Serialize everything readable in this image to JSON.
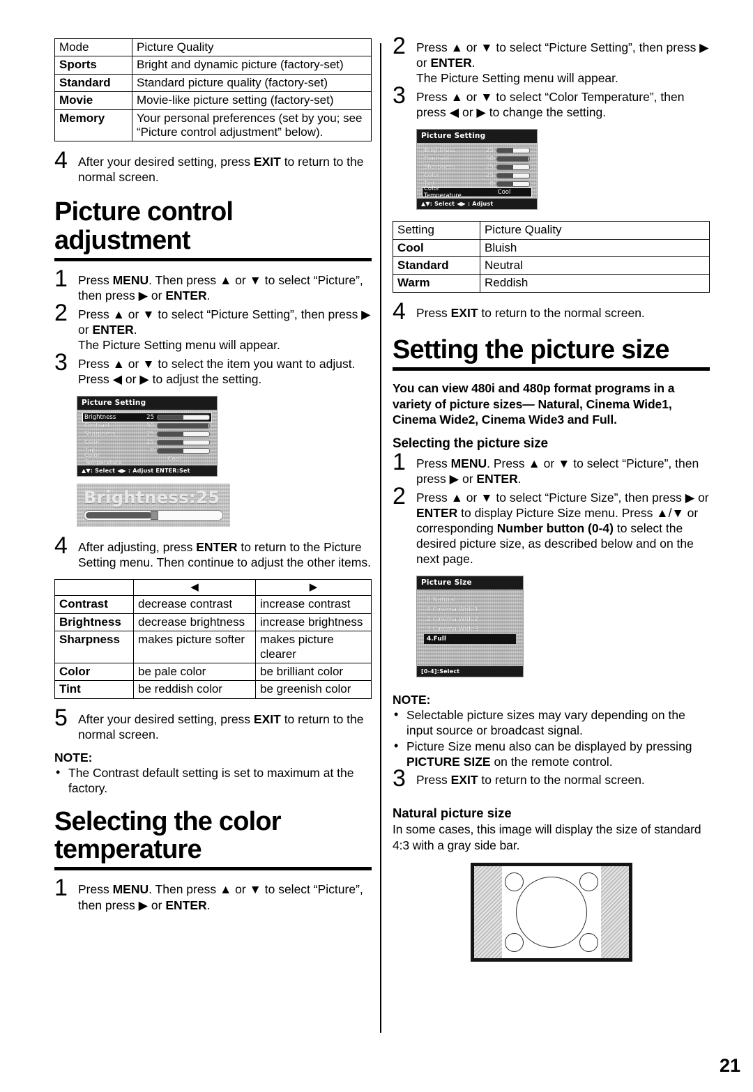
{
  "page": {
    "number": "21"
  },
  "left_column": {
    "picture_quality_table": {
      "header": [
        "Mode",
        "Picture Quality"
      ],
      "rows": [
        {
          "mode": "Sports",
          "quality": "Bright and dynamic picture (factory-set)"
        },
        {
          "mode": "Standard",
          "quality": "Standard picture quality (factory-set)"
        },
        {
          "mode": "Movie",
          "quality": "Movie-like picture setting (factory-set)"
        },
        {
          "mode": "Memory",
          "quality": "Your personal preferences (set by you; see “Picture control adjustment” below)."
        }
      ]
    },
    "step4_above": {
      "num": "4",
      "text_before": "After your desired setting, press ",
      "bold": "EXIT",
      "text_after": " to return to the normal screen."
    },
    "heading_picture_control": "Picture control adjustment",
    "steps": [
      {
        "num": "1",
        "parts": [
          {
            "t": "Press ",
            "b": false
          },
          {
            "t": "MENU",
            "b": true
          },
          {
            "t": ". Then press ▲ or ▼ to select “Picture”, then press ▶ or ",
            "b": false
          },
          {
            "t": "ENTER",
            "b": true
          },
          {
            "t": ".",
            "b": false
          }
        ]
      },
      {
        "num": "2",
        "parts": [
          {
            "t": "Press ▲ or ▼ to select “Picture Setting”, then press ▶ or ",
            "b": false
          },
          {
            "t": "ENTER",
            "b": true
          },
          {
            "t": ".",
            "b": false
          },
          {
            "t": "\nThe Picture Setting menu will appear.",
            "b": false
          }
        ]
      },
      {
        "num": "3",
        "parts": [
          {
            "t": "Press ▲ or ▼ to select the item you want to adjust.",
            "b": false
          },
          {
            "t": "\nPress ◀ or ▶ to adjust the setting.",
            "b": false
          }
        ]
      }
    ],
    "osd_picture_setting": {
      "title": "Picture Setting",
      "rows": [
        {
          "label": "Brightness",
          "value": "25",
          "fill_pct": 50,
          "selected": true
        },
        {
          "label": "Contrast",
          "value": "50",
          "fill_pct": 98,
          "selected": false
        },
        {
          "label": "Sharpness",
          "value": "25",
          "fill_pct": 50,
          "selected": false
        },
        {
          "label": "Color",
          "value": "25",
          "fill_pct": 50,
          "selected": false
        },
        {
          "label": "Tint",
          "value": "0",
          "fill_pct": 50,
          "selected": false
        },
        {
          "label": "Color Temperature",
          "value": "Cool",
          "is_text": true,
          "selected": false
        }
      ],
      "footer": "▲▼: Select   ◀▶ : Adjust   ENTER:Set"
    },
    "osd_brightness_popup": {
      "label": "Brightness:25",
      "fill_pct": 50
    },
    "step4_adjust": {
      "num": "4",
      "parts": [
        {
          "t": "After adjusting, press ",
          "b": false
        },
        {
          "t": "ENTER",
          "b": true
        },
        {
          "t": " to return to the Picture Setting menu. Then continue to adjust the other items.",
          "b": false
        }
      ]
    },
    "adjust_table": {
      "header": [
        "",
        "◀",
        "▶"
      ],
      "rows": [
        {
          "item": "Contrast",
          "left": "decrease contrast",
          "right": "increase contrast"
        },
        {
          "item": "Brightness",
          "left": "decrease brightness",
          "right": "increase brightness"
        },
        {
          "item": "Sharpness",
          "left": "makes picture softer",
          "right": "makes picture clearer"
        },
        {
          "item": "Color",
          "left": "be pale color",
          "right": "be brilliant color"
        },
        {
          "item": "Tint",
          "left": "be reddish color",
          "right": "be greenish color"
        }
      ]
    },
    "step5": {
      "num": "5",
      "parts": [
        {
          "t": "After your desired setting, press ",
          "b": false
        },
        {
          "t": "EXIT",
          "b": true
        },
        {
          "t": " to return to the normal screen.",
          "b": false
        }
      ]
    },
    "note_contrast": {
      "title": "NOTE:",
      "bullets": [
        "The Contrast default setting is set to maximum at the factory."
      ]
    },
    "heading_color_temperature": "Selecting the color temperature",
    "color_temp_step1": {
      "num": "1",
      "parts": [
        {
          "t": "Press ",
          "b": false
        },
        {
          "t": "MENU",
          "b": true
        },
        {
          "t": ". Then press ▲ or ▼ to select “Picture”, then press ▶ or ",
          "b": false
        },
        {
          "t": "ENTER",
          "b": true
        },
        {
          "t": ".",
          "b": false
        }
      ]
    }
  },
  "right_column": {
    "steps_top": [
      {
        "num": "2",
        "parts": [
          {
            "t": "Press ▲ or ▼ to select “Picture Setting”, then press ▶ or ",
            "b": false
          },
          {
            "t": "ENTER",
            "b": true
          },
          {
            "t": ".",
            "b": false
          },
          {
            "t": "\nThe Picture Setting menu will appear.",
            "b": false
          }
        ]
      },
      {
        "num": "3",
        "parts": [
          {
            "t": "Press ▲ or ▼ to select “Color Temperature”, then press ◀ or ▶ to change the setting.",
            "b": false
          }
        ]
      }
    ],
    "osd_picture_setting": {
      "title": "Picture Setting",
      "rows": [
        {
          "label": "Brightness",
          "value": "25",
          "fill_pct": 50,
          "selected": false
        },
        {
          "label": "Contrast",
          "value": "50",
          "fill_pct": 98,
          "selected": false
        },
        {
          "label": "Sharpness",
          "value": "25",
          "fill_pct": 50,
          "selected": false
        },
        {
          "label": "Color",
          "value": "25",
          "fill_pct": 50,
          "selected": false
        },
        {
          "label": "Tint",
          "value": "0",
          "fill_pct": 50,
          "selected": false
        },
        {
          "label": "Color Temperature",
          "value": "Cool",
          "is_text": true,
          "selected": true
        }
      ],
      "footer": "▲▼: Select   ◀▶ : Adjust"
    },
    "color_temp_table": {
      "header": [
        "Setting",
        "Picture Quality"
      ],
      "rows": [
        {
          "setting": "Cool",
          "quality": "Bluish"
        },
        {
          "setting": "Standard",
          "quality": "Neutral"
        },
        {
          "setting": "Warm",
          "quality": "Reddish"
        }
      ]
    },
    "step4_exit": {
      "num": "4",
      "parts": [
        {
          "t": "Press ",
          "b": false
        },
        {
          "t": "EXIT",
          "b": true
        },
        {
          "t": " to return to the normal screen.",
          "b": false
        }
      ]
    },
    "heading_picture_size": "Setting the picture size",
    "intro_bold": "You can view 480i and 480p format programs in a variety of picture sizes— Natural, Cinema Wide1, Cinema Wide2, Cinema Wide3 and Full.",
    "subheading_selecting": "Selecting the picture size",
    "size_steps": [
      {
        "num": "1",
        "parts": [
          {
            "t": "Press ",
            "b": false
          },
          {
            "t": "MENU",
            "b": true
          },
          {
            "t": ". Press ▲ or ▼ to select “Picture”, then press ▶ or ",
            "b": false
          },
          {
            "t": "ENTER",
            "b": true
          },
          {
            "t": ".",
            "b": false
          }
        ]
      },
      {
        "num": "2",
        "parts": [
          {
            "t": "Press ▲ or ▼ to select “Picture Size”, then press ▶ or ",
            "b": false
          },
          {
            "t": "ENTER",
            "b": true
          },
          {
            "t": " to display Picture Size menu. Press ▲/▼ or corresponding ",
            "b": false
          },
          {
            "t": "Number button (0-4)",
            "b": true
          },
          {
            "t": " to select the desired picture size, as described below and on the next page.",
            "b": false
          }
        ]
      }
    ],
    "osd_picture_size": {
      "title": "Picture Size",
      "items": [
        {
          "label": "0.Natural",
          "selected": false
        },
        {
          "label": "1.Cinema Wide1",
          "selected": false
        },
        {
          "label": "2.Cinema Wide2",
          "selected": false
        },
        {
          "label": "3.Cinema Wide3",
          "selected": false
        },
        {
          "label": "4.Full",
          "selected": true
        }
      ],
      "footer": "[0-4]:Select"
    },
    "note_picture_size": {
      "title": "NOTE:",
      "bullets": [
        {
          "parts": [
            {
              "t": "Selectable picture sizes may vary depending on the input source or broadcast signal.",
              "b": false
            }
          ]
        },
        {
          "parts": [
            {
              "t": "Picture Size menu also can be displayed by pressing ",
              "b": false
            },
            {
              "t": "PICTURE SIZE",
              "b": true
            },
            {
              "t": " on the remote control.",
              "b": false
            }
          ]
        }
      ]
    },
    "step3_exit": {
      "num": "3",
      "parts": [
        {
          "t": "Press ",
          "b": false
        },
        {
          "t": "EXIT",
          "b": true
        },
        {
          "t": " to return to the normal screen.",
          "b": false
        }
      ]
    },
    "natural_heading": "Natural picture size",
    "natural_text": "In some cases, this image will display the size of standard 4:3 with a gray side bar."
  }
}
